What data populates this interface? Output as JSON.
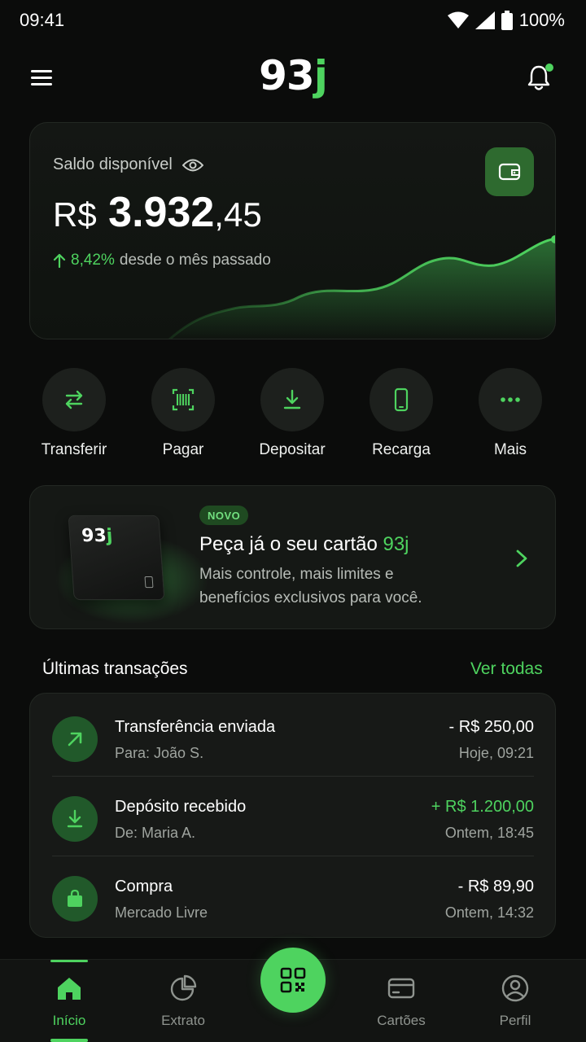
{
  "status_bar": {
    "time": "09:41",
    "battery": "100%"
  },
  "header": {
    "logo_main": "93",
    "logo_accent": "j"
  },
  "balance": {
    "label": "Saldo disponível",
    "currency": "R$",
    "amount_int": "3.932",
    "amount_cents": ",45",
    "change_pct": "8,42%",
    "change_text": "desde o mês passado"
  },
  "actions": [
    {
      "label": "Transferir",
      "icon": "transfer-icon"
    },
    {
      "label": "Pagar",
      "icon": "barcode-icon"
    },
    {
      "label": "Depositar",
      "icon": "download-icon"
    },
    {
      "label": "Recarga",
      "icon": "phone-icon"
    },
    {
      "label": "Mais",
      "icon": "more-icon"
    }
  ],
  "promo": {
    "badge": "NOVO",
    "title_prefix": "Peça já o seu cartão ",
    "title_accent": "93j",
    "subtitle": "Mais controle, mais limites e benefícios exclusivos para você.",
    "card_logo_main": "93",
    "card_logo_accent": "j"
  },
  "transactions": {
    "title": "Últimas transações",
    "see_all": "Ver todas",
    "items": [
      {
        "name": "Transferência enviada",
        "detail": "Para: João S.",
        "amount": "- R$ 250,00",
        "date": "Hoje, 09:21",
        "icon": "arrow-up-right-icon"
      },
      {
        "name": "Depósito recebido",
        "detail": "De: Maria A.",
        "amount": "+ R$ 1.200,00",
        "date": "Ontem, 18:45",
        "icon": "download-icon"
      },
      {
        "name": "Compra",
        "detail": "Mercado Livre",
        "amount": "- R$ 89,90",
        "date": "Ontem, 14:32",
        "icon": "shopping-bag-icon"
      }
    ]
  },
  "bottom_nav": [
    {
      "label": "Início",
      "icon": "home-icon",
      "active": true
    },
    {
      "label": "Extrato",
      "icon": "pie-chart-icon"
    },
    {
      "label": "Cartões",
      "icon": "card-icon"
    },
    {
      "label": "Perfil",
      "icon": "user-icon"
    }
  ],
  "colors": {
    "accent": "#4ed35f",
    "background": "#0b0c0b",
    "card": "#151815"
  }
}
